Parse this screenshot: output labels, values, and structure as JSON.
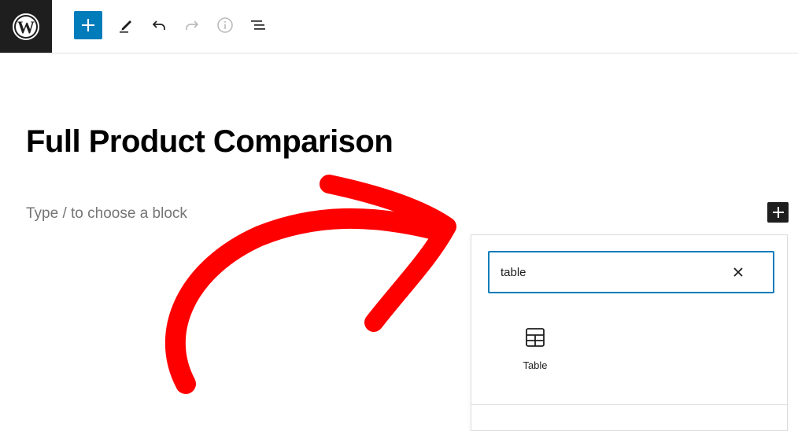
{
  "toolbar": {
    "logo": "wordpress-logo",
    "add_icon": "plus-icon",
    "tools_icon": "pencil-icon",
    "undo_icon": "undo-icon",
    "redo_icon": "redo-icon",
    "details_icon": "info-icon",
    "list_view_icon": "list-view-icon"
  },
  "editor": {
    "post_title": "Full Product Comparison",
    "block_placeholder": "Type / to choose a block"
  },
  "inserter": {
    "search_value": "table",
    "clear_icon": "close-icon",
    "results": [
      {
        "label": "Table",
        "icon": "table-icon"
      }
    ]
  },
  "colors": {
    "accent": "#007cba",
    "dark": "#1e1e1e",
    "annotation": "#ff0000"
  }
}
